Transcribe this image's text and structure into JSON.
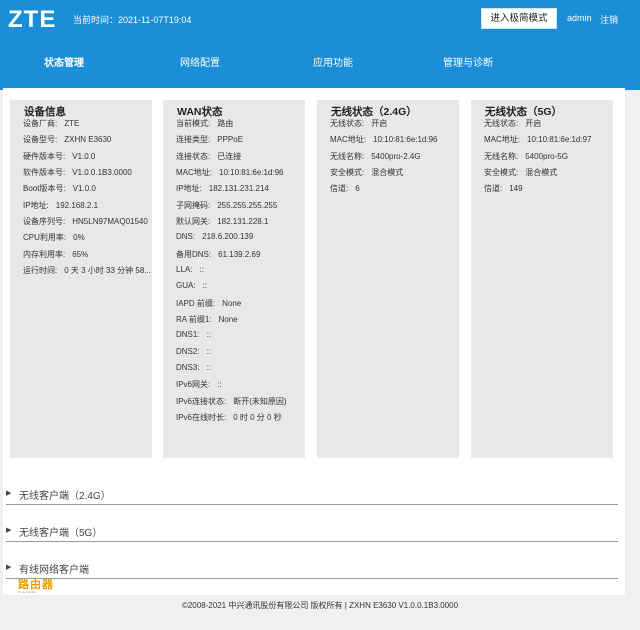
{
  "header": {
    "logo": "ZTE",
    "current_time": "当前时间：2021-11-07T19:04",
    "simple_mode_button": "进入极简模式",
    "user": "admin",
    "logout": "注销"
  },
  "nav": [
    "状态管理",
    "网络配置",
    "应用功能",
    "管理与诊断"
  ],
  "panels": [
    {
      "title": "设备信息",
      "rows": [
        {
          "label": "设备厂商:",
          "value": "ZTE"
        },
        {
          "label": "设备型号:",
          "value": "ZXHN E3630"
        },
        {
          "label": "硬件版本号:",
          "value": "V1.0.0"
        },
        {
          "label": "软件版本号:",
          "value": "V1.0.0.1B3.0000"
        },
        {
          "label": "Boot版本号:",
          "value": "V1.0.0"
        },
        {
          "label": "IP地址:",
          "value": "192.168.2.1"
        },
        {
          "label": "设备序列号:",
          "value": "HN5LN97MAQ01540"
        },
        {
          "label": "CPU利用率:",
          "value": "0%"
        },
        {
          "label": "内存利用率:",
          "value": "65%"
        },
        {
          "label": "运行时间:",
          "value": "0 天 3 小时 33 分钟 58..."
        }
      ]
    },
    {
      "title": "WAN状态",
      "rows": [
        {
          "label": "当前模式:",
          "value": "路由"
        },
        {
          "label": "连接类型:",
          "value": "PPPoE"
        },
        {
          "label": "连接状态:",
          "value": "已连接"
        },
        {
          "label": "MAC地址:",
          "value": "10:10:81:6e:1d:96"
        },
        {
          "label": "IP地址:",
          "value": "182.131.231.214"
        },
        {
          "label": "子网掩码:",
          "value": "255.255.255.255"
        },
        {
          "label": "默认网关:",
          "value": "182.131.228.1"
        },
        {
          "label": "DNS:",
          "value": "218.6.200.139"
        },
        {
          "label": "备用DNS:",
          "value": "61.139.2.69"
        },
        {
          "label": "LLA:",
          "value": "::"
        },
        {
          "label": "GUA:",
          "value": "::"
        },
        {
          "label": "IAPD 前缀:",
          "value": "None"
        },
        {
          "label": "RA 前缀1:",
          "value": "None"
        },
        {
          "label": "DNS1:",
          "value": "::"
        },
        {
          "label": "DNS2:",
          "value": "::"
        },
        {
          "label": "DNS3:",
          "value": "::"
        },
        {
          "label": "IPv6网关:",
          "value": "::"
        },
        {
          "label": "IPv6连接状态:",
          "value": "断开(未知原因)"
        },
        {
          "label": "IPv6在线时长:",
          "value": "0 时 0 分 0 秒"
        }
      ]
    },
    {
      "title": "无线状态（2.4G）",
      "rows": [
        {
          "label": "无线状态:",
          "value": "开启"
        },
        {
          "label": "MAC地址:",
          "value": "10:10:81:6e:1d:96"
        },
        {
          "label": "无线名称:",
          "value": "5400pro-2.4G"
        },
        {
          "label": "安全模式:",
          "value": "混合模式"
        },
        {
          "label": "信道:",
          "value": "6"
        }
      ]
    },
    {
      "title": "无线状态（5G）",
      "rows": [
        {
          "label": "无线状态:",
          "value": "开启"
        },
        {
          "label": "MAC地址:",
          "value": "10:10:81:6e:1d:97"
        },
        {
          "label": "无线名称:",
          "value": "5400pro-5G"
        },
        {
          "label": "安全模式:",
          "value": "混合模式"
        },
        {
          "label": "信道:",
          "value": "149"
        }
      ]
    }
  ],
  "sections": [
    "无线客户端（2.4G）",
    "无线客户端（5G）",
    "有线网络客户端"
  ],
  "watermark": {
    "text": "路由器",
    "sub": "Router Guide"
  },
  "footer": "©2008-2021 中兴通讯股份有限公司 版权所有  |   ZXHN E3630 V1.0.0.1B3.0000"
}
